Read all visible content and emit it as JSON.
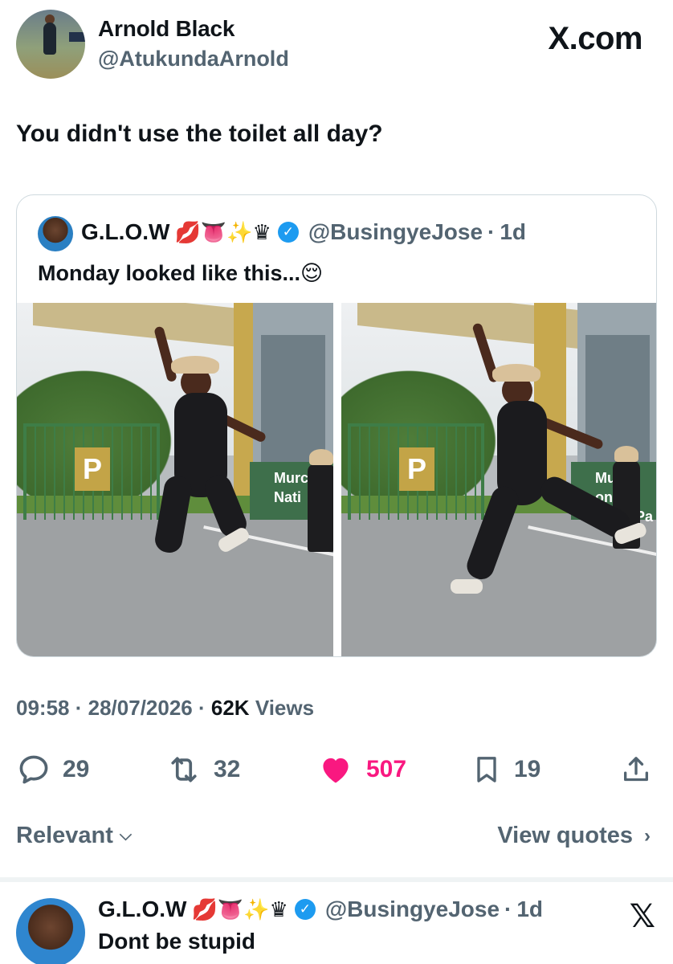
{
  "brand": "X.com",
  "author": {
    "name": "Arnold Black",
    "handle": "@AtukundaArnold"
  },
  "tweet": {
    "text": "You didn't use the toilet all day?",
    "time": "09:58",
    "date": "28/07/2026",
    "views_count": "62K",
    "views_label": "Views"
  },
  "quoted": {
    "name": "G.L.O.W",
    "emojis": "💋👅✨♛",
    "handle": "@BusingyeJose",
    "age": "1d",
    "text": "Monday looked like this...😌",
    "photo_left_sign": "Murc\nNati",
    "photo_right_sign": "Murch on\nNatio Pa",
    "gate_letter": "P"
  },
  "stats": {
    "replies": "29",
    "reposts": "32",
    "likes": "507",
    "bookmarks": "19"
  },
  "sort": {
    "label": "Relevant",
    "view_quotes": "View quotes"
  },
  "reply": {
    "name": "G.L.O.W",
    "emojis": "💋👅✨♛",
    "handle": "@BusingyeJose",
    "age": "1d",
    "text": "Dont be stupid"
  },
  "colors": {
    "like": "#f91880",
    "verified": "#1d9bf0",
    "muted": "#536471"
  },
  "icons": [
    "reply-icon",
    "repost-icon",
    "heart-icon",
    "bookmark-icon",
    "share-icon",
    "verified-icon",
    "x-logo-icon"
  ]
}
